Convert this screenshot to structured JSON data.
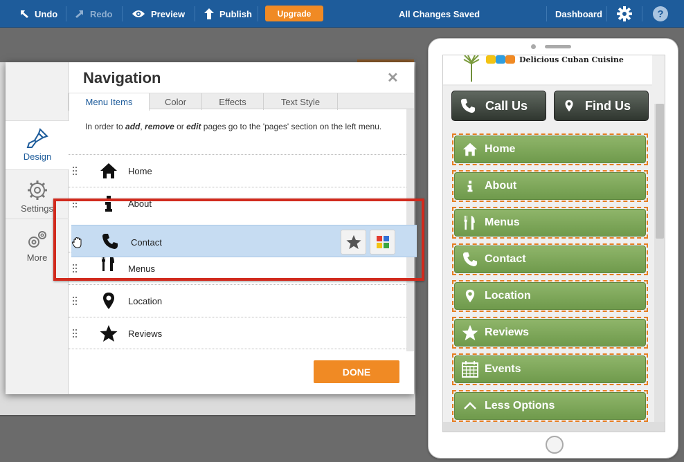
{
  "toolbar": {
    "undo": "Undo",
    "redo": "Redo",
    "preview": "Preview",
    "publish": "Publish",
    "upgrade": "Upgrade",
    "status": "All Changes Saved",
    "dashboard": "Dashboard"
  },
  "sidebar": {
    "items": [
      {
        "label": "Design"
      },
      {
        "label": "Settings"
      },
      {
        "label": "More"
      }
    ]
  },
  "navigation": {
    "title": "Navigation",
    "tabs": [
      {
        "label": "Menu Items"
      },
      {
        "label": "Color"
      },
      {
        "label": "Effects"
      },
      {
        "label": "Text Style"
      }
    ],
    "instructions": {
      "part1": "In order to ",
      "add": "add",
      "sep1": ", ",
      "remove": "remove",
      "sep2": " or ",
      "edit": "edit",
      "part2": " pages go to the 'pages' section on the left menu."
    },
    "items": [
      {
        "label": "Home",
        "icon": "home-icon"
      },
      {
        "label": "About",
        "icon": "info-icon"
      },
      {
        "label": "Menus",
        "icon": "utensils-icon"
      },
      {
        "label": "Location",
        "icon": "map-pin-icon"
      },
      {
        "label": "Reviews",
        "icon": "star-icon"
      }
    ],
    "dragging": {
      "label": "Contact",
      "icon": "phone-icon"
    },
    "done": "DONE"
  },
  "preview": {
    "brand": "Delicious Cuban Cuisine",
    "call": "Call Us",
    "find": "Find Us",
    "menu": [
      {
        "label": "Home",
        "icon": "home-icon"
      },
      {
        "label": "About",
        "icon": "info-icon"
      },
      {
        "label": "Menus",
        "icon": "utensils-icon"
      },
      {
        "label": "Contact",
        "icon": "phone-icon"
      },
      {
        "label": "Location",
        "icon": "map-pin-icon"
      },
      {
        "label": "Reviews",
        "icon": "star-icon"
      },
      {
        "label": "Events",
        "icon": "calendar-icon"
      },
      {
        "label": "Less Options",
        "icon": "chevron-up-icon"
      }
    ]
  },
  "colors": {
    "toolbar": "#1e5c9b",
    "accent": "#f08a24",
    "menu_green": "#7ea85a",
    "highlight": "#d12a1d"
  }
}
